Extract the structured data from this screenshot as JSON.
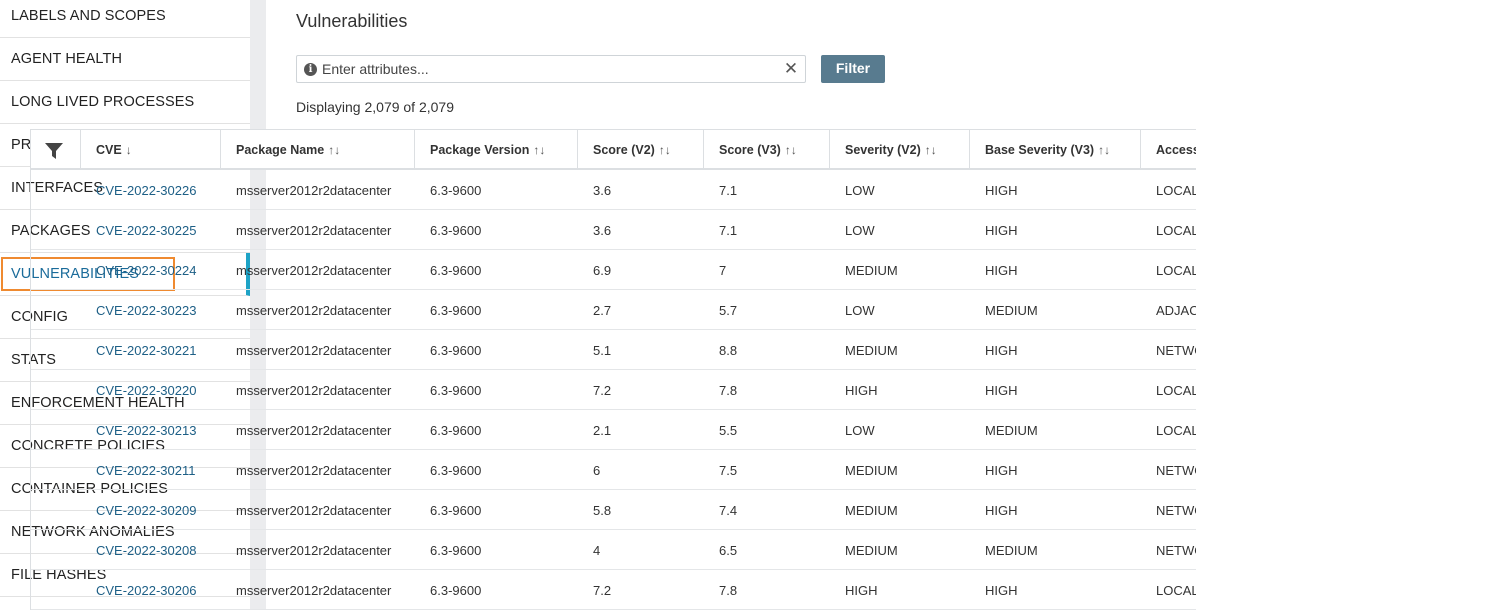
{
  "sidebar": {
    "items": [
      {
        "label": "LABELS AND SCOPES",
        "active": false
      },
      {
        "label": "AGENT HEALTH",
        "active": false
      },
      {
        "label": "LONG LIVED PROCESSES",
        "active": false
      },
      {
        "label": "PROCESS SNAPSHOTS",
        "active": false
      },
      {
        "label": "INTERFACES",
        "active": false
      },
      {
        "label": "PACKAGES",
        "active": false
      },
      {
        "label": "VULNERABILITIES",
        "active": true
      },
      {
        "label": "CONFIG",
        "active": false
      },
      {
        "label": "STATS",
        "active": false
      },
      {
        "label": "ENFORCEMENT HEALTH",
        "active": false
      },
      {
        "label": "CONCRETE POLICIES",
        "active": false
      },
      {
        "label": "CONTAINER POLICIES",
        "active": false
      },
      {
        "label": "NETWORK ANOMALIES",
        "active": false
      },
      {
        "label": "FILE HASHES",
        "active": false
      }
    ]
  },
  "main": {
    "title": "Vulnerabilities",
    "search": {
      "placeholder": "Enter attributes...",
      "value": "",
      "info_icon": "i",
      "clear_icon": "✕"
    },
    "filter_button": "Filter",
    "displaying": "Displaying 2,079 of 2,079"
  },
  "table": {
    "columns": [
      {
        "label": "CVE",
        "sort": "↓"
      },
      {
        "label": "Package Name",
        "sort": "↑↓"
      },
      {
        "label": "Package Version",
        "sort": "↑↓"
      },
      {
        "label": "Score (V2)",
        "sort": "↑↓"
      },
      {
        "label": "Score (V3)",
        "sort": "↑↓"
      },
      {
        "label": "Severity (V2)",
        "sort": "↑↓"
      },
      {
        "label": "Base Severity (V3)",
        "sort": "↑↓"
      },
      {
        "label": "Access",
        "sort": ""
      }
    ],
    "rows": [
      [
        "CVE-2022-30226",
        "msserver2012r2datacenter",
        "6.3-9600",
        "3.6",
        "7.1",
        "LOW",
        "HIGH",
        "LOCAL"
      ],
      [
        "CVE-2022-30225",
        "msserver2012r2datacenter",
        "6.3-9600",
        "3.6",
        "7.1",
        "LOW",
        "HIGH",
        "LOCAL"
      ],
      [
        "CVE-2022-30224",
        "msserver2012r2datacenter",
        "6.3-9600",
        "6.9",
        "7",
        "MEDIUM",
        "HIGH",
        "LOCAL"
      ],
      [
        "CVE-2022-30223",
        "msserver2012r2datacenter",
        "6.3-9600",
        "2.7",
        "5.7",
        "LOW",
        "MEDIUM",
        "ADJACENT_NETWORK"
      ],
      [
        "CVE-2022-30221",
        "msserver2012r2datacenter",
        "6.3-9600",
        "5.1",
        "8.8",
        "MEDIUM",
        "HIGH",
        "NETWORK"
      ],
      [
        "CVE-2022-30220",
        "msserver2012r2datacenter",
        "6.3-9600",
        "7.2",
        "7.8",
        "HIGH",
        "HIGH",
        "LOCAL"
      ],
      [
        "CVE-2022-30213",
        "msserver2012r2datacenter",
        "6.3-9600",
        "2.1",
        "5.5",
        "LOW",
        "MEDIUM",
        "LOCAL"
      ],
      [
        "CVE-2022-30211",
        "msserver2012r2datacenter",
        "6.3-9600",
        "6",
        "7.5",
        "MEDIUM",
        "HIGH",
        "NETWORK"
      ],
      [
        "CVE-2022-30209",
        "msserver2012r2datacenter",
        "6.3-9600",
        "5.8",
        "7.4",
        "MEDIUM",
        "HIGH",
        "NETWORK"
      ],
      [
        "CVE-2022-30208",
        "msserver2012r2datacenter",
        "6.3-9600",
        "4",
        "6.5",
        "MEDIUM",
        "MEDIUM",
        "NETWORK"
      ],
      [
        "CVE-2022-30206",
        "msserver2012r2datacenter",
        "6.3-9600",
        "7.2",
        "7.8",
        "HIGH",
        "HIGH",
        "LOCAL"
      ]
    ]
  }
}
